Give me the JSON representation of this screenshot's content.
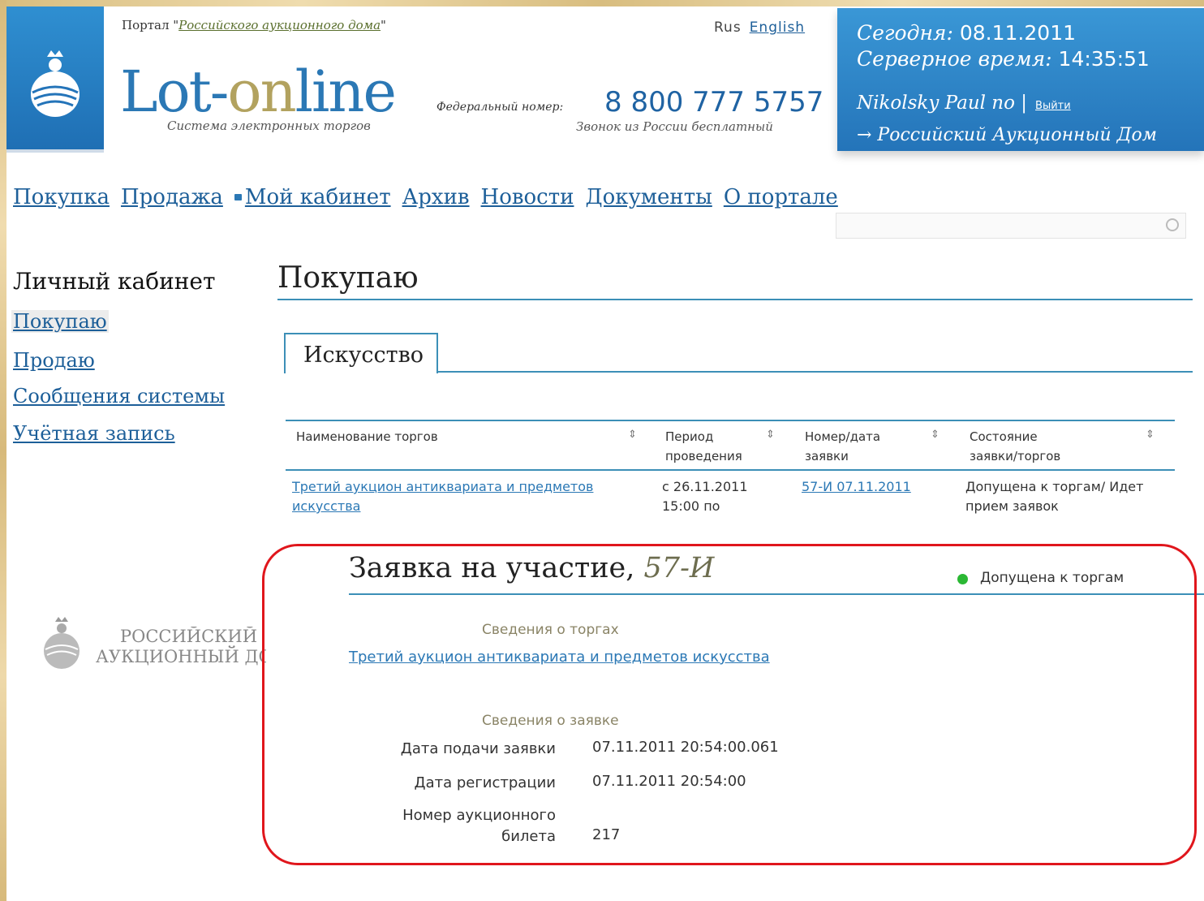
{
  "header": {
    "portal_prefix": "Портал \"",
    "portal_link": "Российского аукционного дома",
    "portal_suffix": "\"",
    "brand_part1": "Lot-",
    "brand_part2": "on",
    "brand_part3": "line",
    "tagline": "Система электронных торгов",
    "lang_current": "Rus",
    "lang_other": "English",
    "phone_label": "Федеральный номер:",
    "phone_number": "8 800 777 5757",
    "phone_note": "Звонок из России бесплатный"
  },
  "infobox": {
    "today_label": "Сегодня:",
    "today_value": "08.11.2011",
    "time_label": "Серверное время:",
    "time_value": "14:35:51",
    "user": "Nikolsky Paul по |",
    "logout": "Выйти",
    "org": "→ Российский Аукционный Дом"
  },
  "nav": {
    "items": [
      "Покупка",
      "Продажа",
      "Мой кабинет",
      "Архив",
      "Новости",
      "Документы",
      "О портале"
    ]
  },
  "search": {
    "placeholder": ""
  },
  "sidebar": {
    "title": "Личный кабинет",
    "items": [
      "Покупаю",
      "Продаю",
      "Сообщения системы",
      "Учётная запись"
    ],
    "org_logo_line1": "РОССИЙСКИЙ",
    "org_logo_line2": "АУКЦИОННЫЙ ДОМ"
  },
  "main": {
    "title": "Покупаю",
    "tab": "Искусство",
    "table": {
      "headers": [
        "Наименование торгов",
        "Период проведения",
        "Номер/дата заявки",
        "Состояние заявки/торгов"
      ],
      "rows": [
        {
          "name": "Третий аукцион антиквариата и предметов искусства",
          "period": "с 26.11.2011 15:00 по",
          "number": "57-И 07.11.2011",
          "status": "Допущена к торгам/ Идет прием заявок"
        }
      ]
    }
  },
  "application": {
    "title": "Заявка на участие,",
    "number": "57-И",
    "status": "Допущена к торгам",
    "section_auction": "Сведения о торгах",
    "auction_link": "Третий аукцион антиквариата и предметов искусства",
    "section_application": "Сведения о заявке",
    "fields": [
      {
        "label": "Дата подачи заявки",
        "value": "07.11.2011 20:54:00.061"
      },
      {
        "label": "Дата регистрации",
        "value": "07.11.2011 20:54:00"
      },
      {
        "label": "Номер аукционного билета",
        "value": "217"
      }
    ]
  },
  "colors": {
    "accent": "#3c8fb7",
    "link": "#1d5f99",
    "header_blue": "#2474b9",
    "highlight": "#e0161c",
    "status_ok": "#2bb834",
    "outer": "#e9d6a6"
  }
}
